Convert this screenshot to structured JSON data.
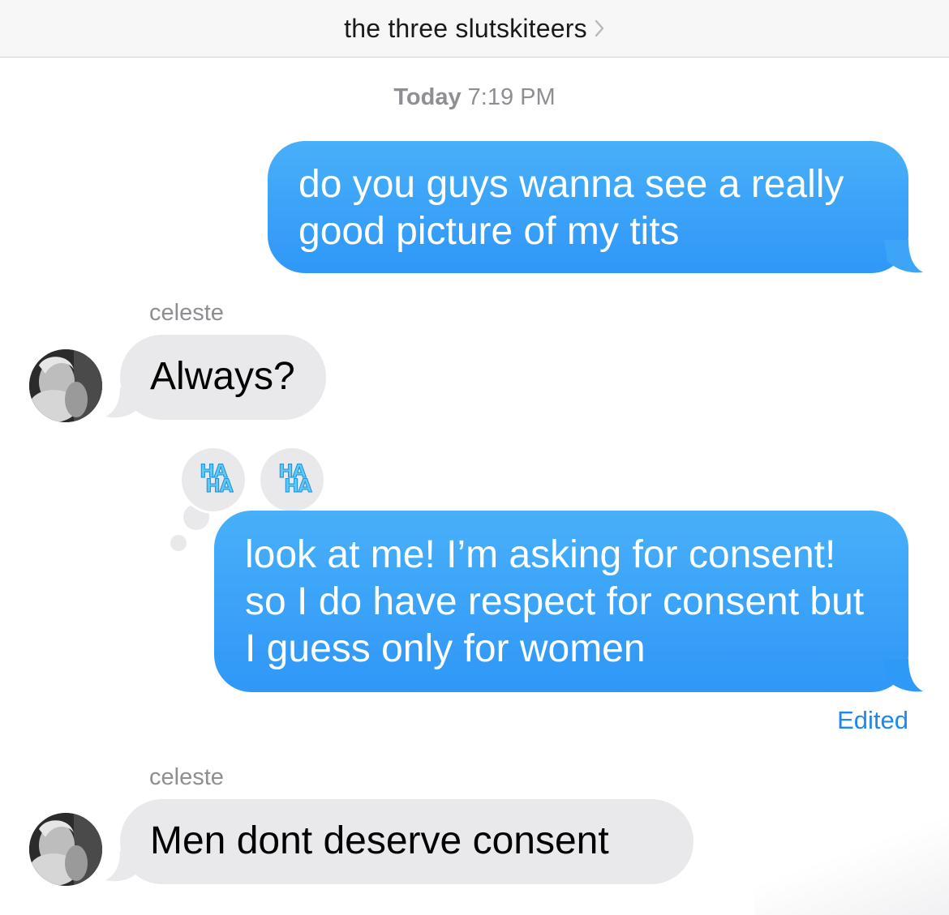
{
  "header": {
    "title": "the three slutskiteers",
    "chevron_icon": "chevron-right-icon"
  },
  "timestamp": {
    "day": "Today",
    "time": "7:19 PM"
  },
  "messages": [
    {
      "direction": "outgoing",
      "text": "do you guys wanna see a really good picture of my tits"
    },
    {
      "direction": "incoming",
      "sender": "celeste",
      "text": "Always?"
    },
    {
      "direction": "outgoing",
      "text": "look at me! I’m asking for consent! so I do have respect for consent but I guess only for women",
      "tapbacks": [
        {
          "icon": "haha-icon",
          "lines": [
            "HA",
            "HA"
          ]
        },
        {
          "icon": "haha-icon",
          "lines": [
            "HA",
            "HA"
          ]
        }
      ],
      "status": "Edited"
    },
    {
      "direction": "incoming",
      "sender": "celeste",
      "text": "Men dont deserve consent"
    }
  ],
  "colors": {
    "outgoing_bubble": "#2f97f7",
    "incoming_bubble": "#e9e9eb",
    "edited_text": "#1e88f2",
    "meta_text": "#8e8e93"
  }
}
